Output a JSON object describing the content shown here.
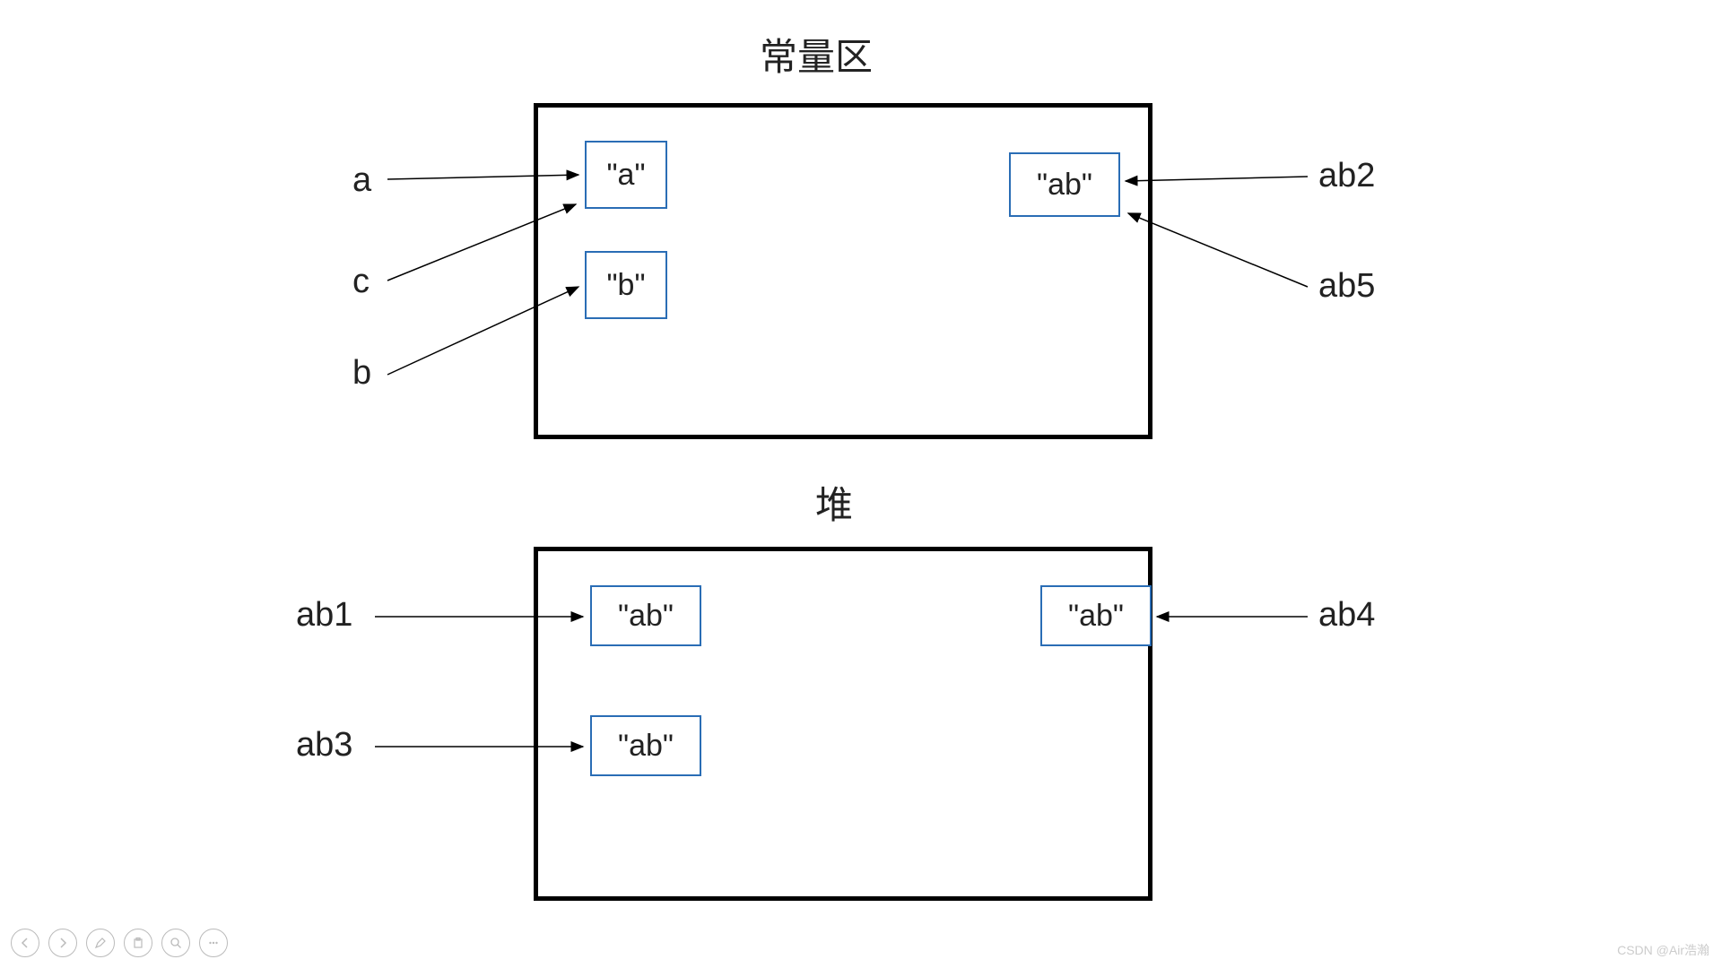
{
  "titles": {
    "constant_pool": "常量区",
    "heap": "堆"
  },
  "constant_pool": {
    "cells": {
      "a": "\"a\"",
      "b": "\"b\"",
      "ab": "\"ab\""
    }
  },
  "heap": {
    "cells": {
      "ab_left_top": "\"ab\"",
      "ab_left_bottom": "\"ab\"",
      "ab_right_top": "\"ab\""
    }
  },
  "variables": {
    "a": "a",
    "c": "c",
    "b": "b",
    "ab1": "ab1",
    "ab3": "ab3",
    "ab2": "ab2",
    "ab5": "ab5",
    "ab4": "ab4"
  },
  "watermark": "CSDN @Air浩瀚",
  "toolbar_icons": [
    "prev",
    "next",
    "pen",
    "clipboard",
    "search",
    "more"
  ]
}
